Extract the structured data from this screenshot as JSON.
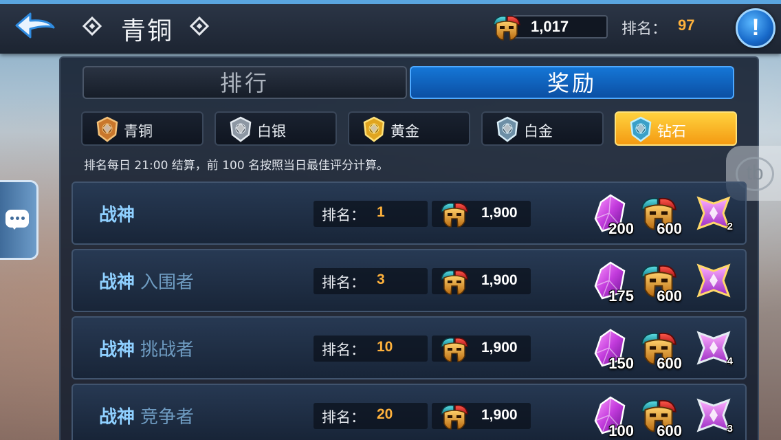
{
  "header": {
    "title": "青铜",
    "currency_value": "1,017",
    "rank_label": "排名：",
    "rank_value": "97",
    "info_symbol": "!"
  },
  "tabs": [
    {
      "label": "排行",
      "active": false
    },
    {
      "label": "奖励",
      "active": true
    }
  ],
  "tiers": [
    {
      "label": "青铜",
      "icon": "bronze-emblem-icon",
      "active": false
    },
    {
      "label": "白银",
      "icon": "silver-emblem-icon",
      "active": false
    },
    {
      "label": "黄金",
      "icon": "gold-emblem-icon",
      "active": false
    },
    {
      "label": "白金",
      "icon": "platinum-emblem-icon",
      "active": false
    },
    {
      "label": "钻石",
      "icon": "diamond-emblem-icon",
      "active": true
    }
  ],
  "notice": "排名每日 21:00 结算，前 100 名按照当日最佳评分计算。",
  "rank_label": "排名：",
  "rows": [
    {
      "title": "战神",
      "subtitle": "",
      "rank": "1",
      "score": "1,900",
      "crystals": "200",
      "helmets": "600",
      "badge_count": "2"
    },
    {
      "title": "战神",
      "subtitle": "入围者",
      "rank": "3",
      "score": "1,900",
      "crystals": "175",
      "helmets": "600",
      "badge_count": ""
    },
    {
      "title": "战神",
      "subtitle": "挑战者",
      "rank": "10",
      "score": "1,900",
      "crystals": "150",
      "helmets": "600",
      "badge_count": "4"
    },
    {
      "title": "战神",
      "subtitle": "竞争者",
      "rank": "20",
      "score": "1,900",
      "crystals": "100",
      "helmets": "600",
      "badge_count": "3"
    }
  ],
  "floating_button_text": "tb",
  "colors": {
    "accent_blue": "#1576d6",
    "active_tier": "#f49a12",
    "rank_number": "#ffb23c",
    "row_title": "#8fd0ff"
  }
}
